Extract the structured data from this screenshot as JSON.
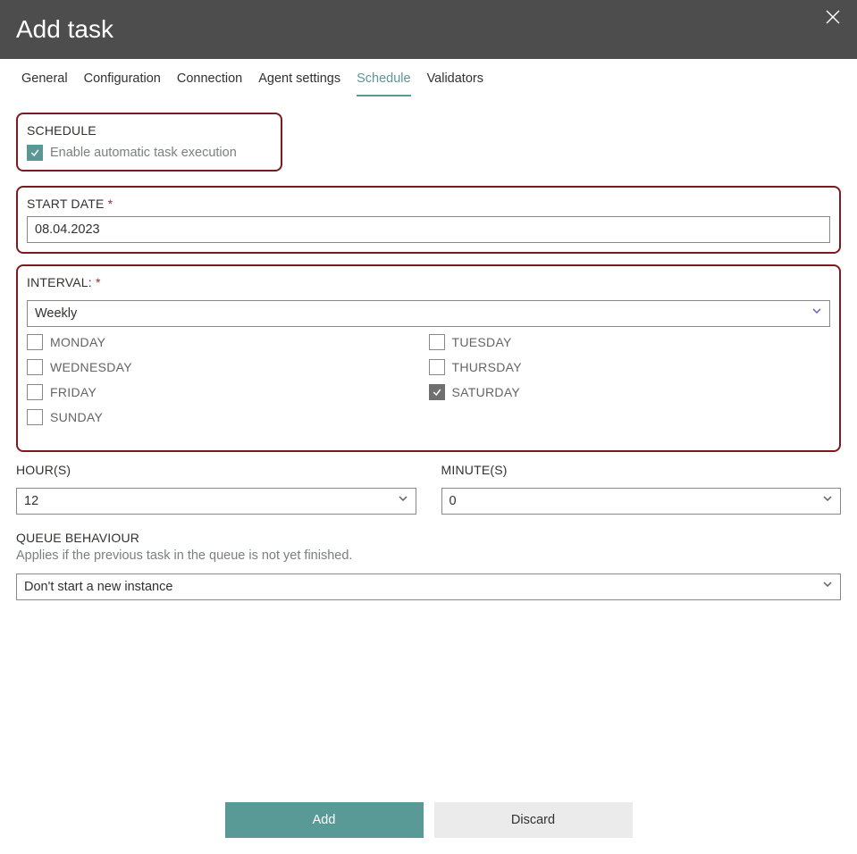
{
  "header": {
    "title": "Add task"
  },
  "tabs": [
    {
      "label": "General",
      "active": false
    },
    {
      "label": "Configuration",
      "active": false
    },
    {
      "label": "Connection",
      "active": false
    },
    {
      "label": "Agent settings",
      "active": false
    },
    {
      "label": "Schedule",
      "active": true
    },
    {
      "label": "Validators",
      "active": false
    }
  ],
  "schedule": {
    "heading": "SCHEDULE",
    "enable_label": "Enable automatic task execution",
    "enable_checked": true
  },
  "start_date": {
    "label": "START DATE",
    "value": "08.04.2023",
    "required": true
  },
  "interval": {
    "label": "INTERVAL:",
    "value": "Weekly",
    "required": true
  },
  "days": [
    {
      "key": "monday",
      "label": "MONDAY",
      "checked": false
    },
    {
      "key": "tuesday",
      "label": "TUESDAY",
      "checked": false
    },
    {
      "key": "wednesday",
      "label": "WEDNESDAY",
      "checked": false
    },
    {
      "key": "thursday",
      "label": "THURSDAY",
      "checked": false
    },
    {
      "key": "friday",
      "label": "FRIDAY",
      "checked": false
    },
    {
      "key": "saturday",
      "label": "SATURDAY",
      "checked": true
    },
    {
      "key": "sunday",
      "label": "SUNDAY",
      "checked": false
    }
  ],
  "hours": {
    "label": "HOUR(S)",
    "value": "12"
  },
  "minutes": {
    "label": "MINUTE(S)",
    "value": "0"
  },
  "queue": {
    "label": "QUEUE BEHAVIOUR",
    "help": "Applies if the previous task in the queue is not yet finished.",
    "value": "Don't start a new instance"
  },
  "footer": {
    "add": "Add",
    "discard": "Discard"
  },
  "annotations": {
    "arrow_color": "#7a1b1f",
    "highlight_color": "#7a1b1f"
  }
}
